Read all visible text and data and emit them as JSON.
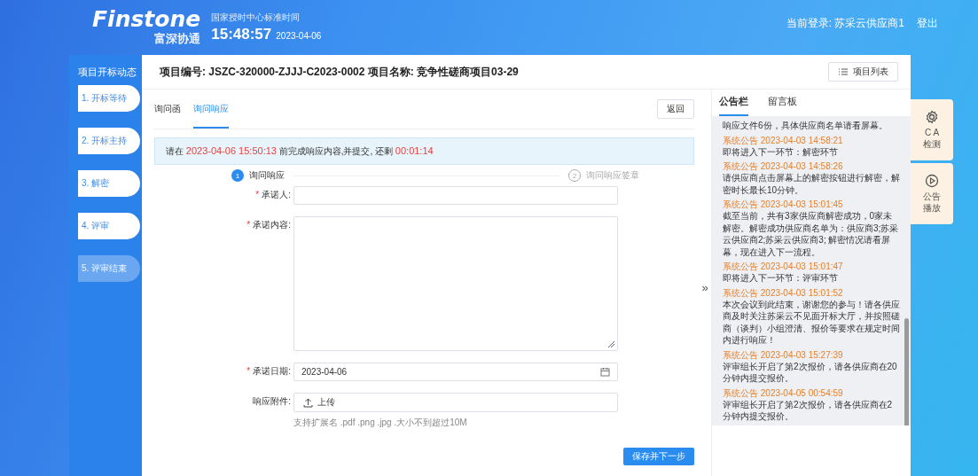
{
  "header": {
    "logo_name": "Finstone",
    "logo_sub": "富深协通",
    "time_label": "国家授时中心标准时间",
    "time": "15:48:57",
    "date": "2023-04-06",
    "user": "当前登录: 苏采云供应商1",
    "logout": "登出"
  },
  "sidebar": {
    "title": "项目开标动态",
    "items": [
      {
        "label": "1. 开标等待",
        "disabled": false
      },
      {
        "label": "2. 开标主持",
        "disabled": false
      },
      {
        "label": "3. 解密",
        "disabled": false
      },
      {
        "label": "4. 评审",
        "disabled": false
      },
      {
        "label": "5. 评审结束",
        "disabled": true
      }
    ]
  },
  "project": {
    "title": "项目编号: JSZC-320000-ZJJJ-C2023-0002 项目名称: 竞争性磋商项目03-29",
    "list_button": "项目列表"
  },
  "tabs": [
    {
      "label": "询问函",
      "selected": false
    },
    {
      "label": "询问响应",
      "selected": true
    }
  ],
  "back_button": "返回",
  "notice": [
    {
      "kind": "plain",
      "text": "请在 "
    },
    {
      "kind": "highlight",
      "text": "2023-04-06 15:50:13"
    },
    {
      "kind": "plain",
      "text": " 前完成响应内容,并提交, 还剩 "
    },
    {
      "kind": "highlight",
      "text": "00:01:14"
    }
  ],
  "steps": [
    {
      "number": "1",
      "label": "询问响应",
      "active": true
    },
    {
      "number": "2",
      "label": "询问响应签章",
      "active": false
    }
  ],
  "form": [
    {
      "kind": "input",
      "label": "承诺人:",
      "required_mark": "*"
    },
    {
      "kind": "textarea",
      "label": "承诺内容:",
      "required_mark": "*"
    },
    {
      "kind": "date",
      "label": "承诺日期:",
      "required_mark": "*",
      "value": "2023-04-06"
    },
    {
      "kind": "upload",
      "label": "响应附件:",
      "button": "上传",
      "hint": "支持扩展名 .pdf .png .jpg .大小不到超过10M"
    }
  ],
  "submit_button": "保存并下一步",
  "collapse": "»",
  "board_tabs": [
    {
      "label": "公告栏",
      "selected": true
    },
    {
      "label": "留言板",
      "selected": false
    }
  ],
  "announcements": [
    {
      "body": "响应文件6份，具体供应商名单请看屏幕。"
    },
    {
      "title": "系统公告 2023-04-03 14:58:21",
      "body": "即将进入下一环节：解密环节"
    },
    {
      "title": "系统公告 2023-04-03 14:58:26",
      "body": "请供应商点击屏幕上的解密按钮进行解密，解密时长最长10分钟。"
    },
    {
      "title": "系统公告 2023-04-03 15:01:45",
      "body": "截至当前，共有3家供应商解密成功，0家未解密。解密成功供应商名单为：供应商3;苏采云供应商2;苏采云供应商3; 解密情况请看屏幕，现在进入下一流程。"
    },
    {
      "title": "系统公告 2023-04-03 15:01:47",
      "body": "即将进入下一环节：评审环节"
    },
    {
      "title": "系统公告 2023-04-03 15:01:52",
      "body": "本次会议到此结束，谢谢您的参与！请各供应商及时关注苏采云不见面开标大厅，并按照磋商（谈判）小组澄清、报价等要求在规定时间内进行响应！"
    },
    {
      "title": "系统公告 2023-04-03 15:27:39",
      "body": "评审组长开启了第2次报价，请各供应商在20分钟内提交报价。"
    },
    {
      "title": "系统公告 2023-04-05 00:54:59",
      "body": "评审组长开启了第2次报价，请各供应商在2分钟内提交报价。"
    }
  ],
  "tools": [
    {
      "kind": "gear",
      "lines": [
        "C A",
        "检测"
      ]
    },
    {
      "kind": "play",
      "lines": [
        "公告",
        "播放"
      ]
    }
  ]
}
